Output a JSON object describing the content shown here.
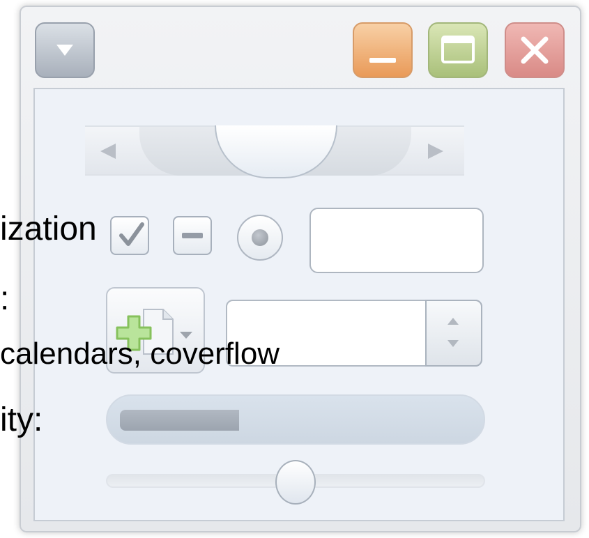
{
  "window": {
    "buttons": {
      "menu_icon": "menu-dropdown-icon",
      "minimize_icon": "minimize-icon",
      "maximize_icon": "maximize-icon",
      "close_icon": "close-icon"
    },
    "colors": {
      "minimize": "#e99a58",
      "maximize": "#a9c07a",
      "close": "#d98a86"
    }
  },
  "labels": {
    "line1": "ization",
    "line2": ":",
    "line3": "calendars, coverflow",
    "line4": "ity:"
  },
  "controls": {
    "checkbox_checked": true,
    "checkbox_indeterminate": true,
    "radio_selected": true,
    "text_field_value": "",
    "combo_value": "",
    "progress_fraction": 0.34,
    "slider_fraction": 0.5,
    "split_button_icon": "add-document-icon"
  }
}
